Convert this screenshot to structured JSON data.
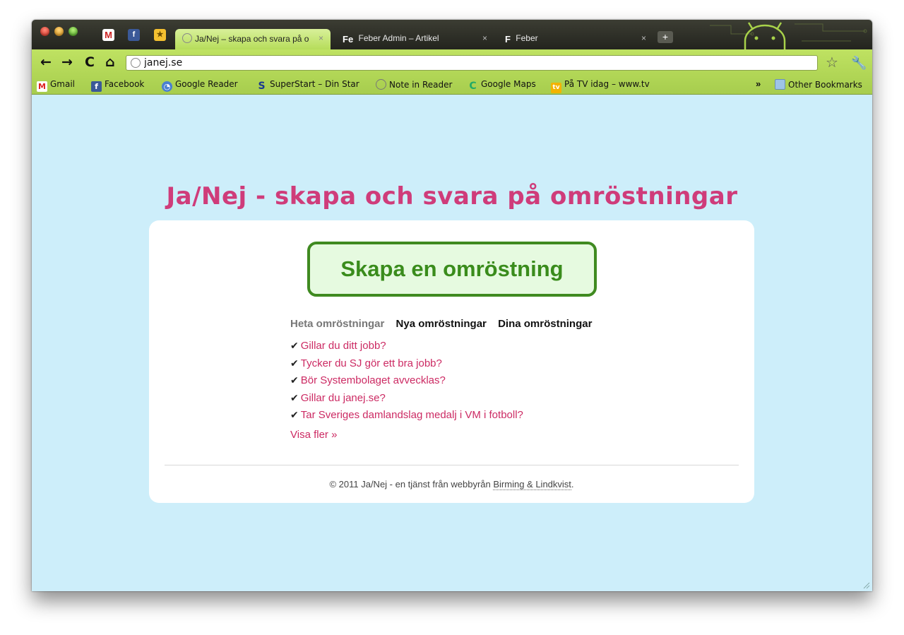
{
  "browser": {
    "tabs": [
      {
        "title": "Ja/Nej – skapa och svara på o",
        "active": true
      },
      {
        "title": "Feber Admin – Artikel",
        "favicon_text": "Fe",
        "active": false
      },
      {
        "title": "Feber",
        "favicon_text": "F",
        "active": false
      }
    ],
    "pinned": [
      {
        "icon": "gmail-icon",
        "glyph": "M"
      },
      {
        "icon": "facebook-icon",
        "glyph": "f"
      },
      {
        "icon": "star-app-icon",
        "glyph": "★"
      }
    ],
    "close_glyph": "×",
    "newtab_glyph": "+",
    "url": "janej.se",
    "back_glyph": "←",
    "forward_glyph": "→",
    "reload_glyph": "C",
    "home_glyph": "⌂",
    "star_glyph": "☆",
    "wrench_glyph": "🔧",
    "accent_color": "#b6dd5a",
    "bookmarks": [
      {
        "label": "Gmail",
        "icon": "gmail-icon",
        "glyph": "M"
      },
      {
        "label": "Facebook",
        "icon": "facebook-icon",
        "glyph": "f"
      },
      {
        "label": "Google Reader",
        "icon": "google-reader-icon",
        "glyph": "◔"
      },
      {
        "label": "SuperStart – Din Star",
        "icon": "superstart-icon",
        "glyph": "S"
      },
      {
        "label": "Note in Reader",
        "icon": "globe-icon",
        "glyph": ""
      },
      {
        "label": "Google Maps",
        "icon": "google-maps-icon",
        "glyph": "C"
      },
      {
        "label": "På TV idag – www.tv",
        "icon": "tv-icon",
        "glyph": "tv"
      }
    ],
    "bookmarks_overflow": "»",
    "other_bookmarks": "Other Bookmarks"
  },
  "page": {
    "title": "Ja/Nej - skapa och svara på omröstningar",
    "create_button": "Skapa en omröstning",
    "tabs": [
      "Heta omröstningar",
      "Nya omröstningar",
      "Dina omröstningar"
    ],
    "check_glyph": "✔",
    "polls": [
      "Gillar du ditt jobb?",
      "Tycker du SJ gör ett bra jobb?",
      "Bör Systembolaget avvecklas?",
      "Gillar du janej.se?",
      "Tar Sveriges damlandslag medalj i VM i fotboll?"
    ],
    "show_more": "Visa fler »",
    "footer_prefix": "© 2011 Ja/Nej - en tjänst från webbyrån ",
    "footer_link": "Birming & Lindkvist",
    "footer_suffix": ".",
    "colors": {
      "background": "#cdeefa",
      "title": "#cf3c7a",
      "link": "#cc2a63",
      "button_border": "#3f8a20",
      "button_fill": "#e6fae0"
    }
  }
}
